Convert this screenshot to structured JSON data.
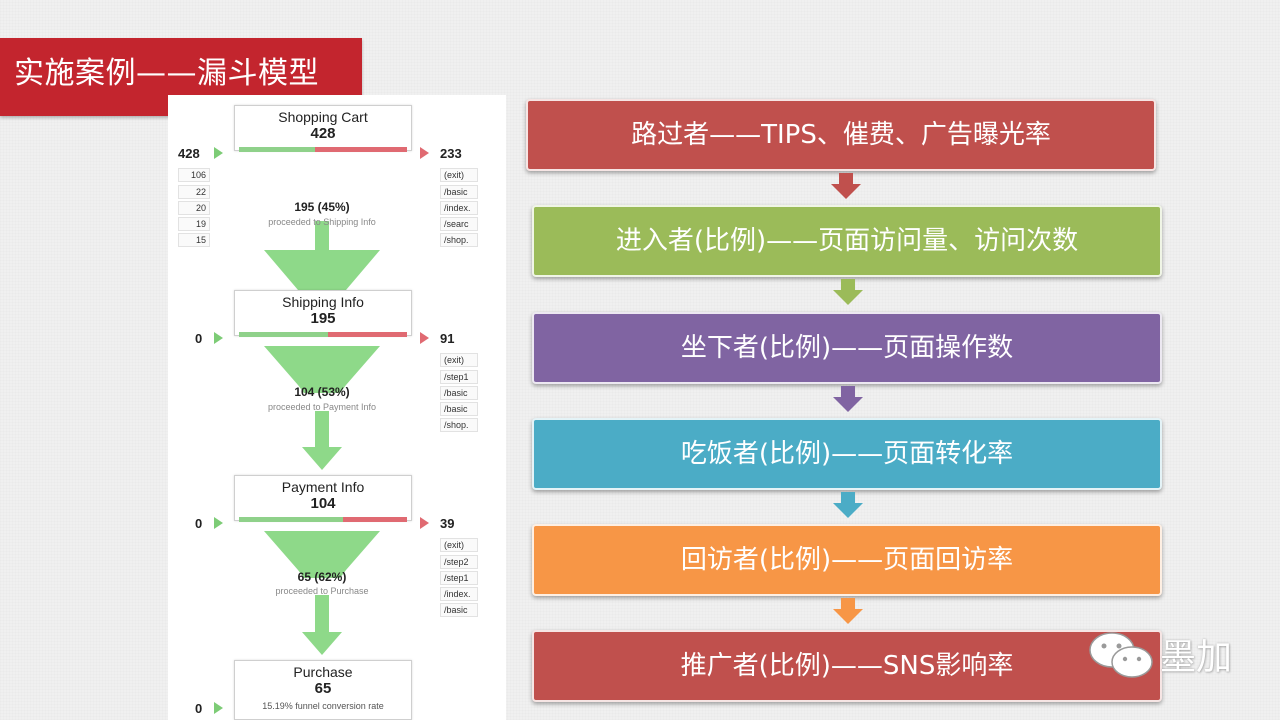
{
  "title": "实施案例——漏斗模型",
  "funnel": {
    "stages": [
      {
        "name": "Shopping Cart",
        "count": "428",
        "left_value": "428",
        "right_value": "233",
        "left_cells": [
          "106",
          "22",
          "20",
          "19",
          "15"
        ],
        "right_cells": [
          "(exit)",
          "/basic",
          "/index.",
          "/searc",
          "/shop."
        ],
        "bar_fraction": 0.45
      },
      {
        "name": "Shipping Info",
        "count": "195",
        "left_value": "0",
        "right_value": "91",
        "left_cells": [],
        "right_cells": [
          "(exit)",
          "/step1",
          "/basic",
          "/basic",
          "/shop."
        ],
        "bar_fraction": 0.53
      },
      {
        "name": "Payment Info",
        "count": "104",
        "left_value": "0",
        "right_value": "39",
        "left_cells": [],
        "right_cells": [
          "(exit)",
          "/step2",
          "/step1",
          "/index.",
          "/basic"
        ],
        "bar_fraction": 0.62
      },
      {
        "name": "Purchase",
        "count": "65",
        "left_value": "0",
        "right_value": "",
        "left_cells": [],
        "right_cells": [],
        "bar_fraction": 1.0,
        "note": "15.19% funnel conversion rate"
      }
    ],
    "transitions": [
      {
        "count": "195 (45%)",
        "label": "proceeded to Shipping Info"
      },
      {
        "count": "104 (53%)",
        "label": "proceeded to Payment Info"
      },
      {
        "count": "65 (62%)",
        "label": "proceeded to Purchase"
      }
    ],
    "colors": {
      "green": "#7dcc76",
      "red": "#e06a72"
    }
  },
  "flow": [
    {
      "text": "路过者——TIPS、催费、广告曝光率",
      "color": "#c0504d"
    },
    {
      "text": "进入者(比例)——页面访问量、访问次数",
      "color": "#9bbb59"
    },
    {
      "text": "坐下者(比例)——页面操作数",
      "color": "#8064a2"
    },
    {
      "text": "吃饭者(比例)——页面转化率",
      "color": "#4bacc6"
    },
    {
      "text": "回访者(比例)——页面回访率",
      "color": "#f79646"
    },
    {
      "text": "推广者(比例)——SNS影响率",
      "color": "#c0504d"
    }
  ],
  "watermark": {
    "text": "墨加",
    "icon": "wechat-icon"
  }
}
